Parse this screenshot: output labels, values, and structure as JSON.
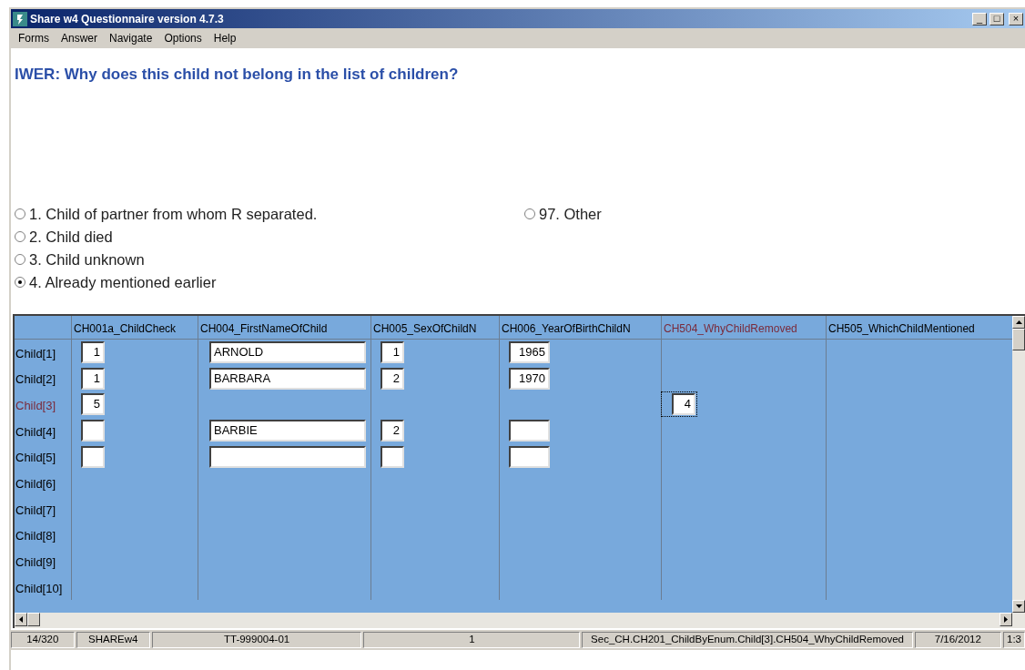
{
  "window": {
    "title": "Share w4 Questionnaire version 4.7.3",
    "controls": [
      "_",
      "□",
      "×"
    ]
  },
  "menu": [
    "Forms",
    "Answer",
    "Navigate",
    "Options",
    "Help"
  ],
  "question": "IWER: Why does this child not belong in the list of children?",
  "option_columns": [
    [
      {
        "label": "1. Child of partner from whom R separated.",
        "selected": false
      },
      {
        "label": "2. Child died",
        "selected": false
      },
      {
        "label": "3. Child unknown",
        "selected": false
      },
      {
        "label": "4. Already mentioned earlier",
        "selected": true
      }
    ],
    [
      {
        "label": "97. Other",
        "selected": false
      }
    ]
  ],
  "table": {
    "columns": [
      {
        "header": "CH001a_ChildCheck",
        "current": false
      },
      {
        "header": "CH004_FirstNameOfChild",
        "current": false
      },
      {
        "header": "CH005_SexOfChildN",
        "current": false
      },
      {
        "header": "CH006_YearOfBirthChildN",
        "current": false
      },
      {
        "header": "CH504_WhyChildRemoved",
        "current": true
      },
      {
        "header": "CH505_WhichChildMentioned",
        "current": false
      }
    ],
    "rows": [
      {
        "label": "Child[1]",
        "current": false,
        "cells": [
          {
            "kind": "field",
            "value": "1"
          },
          {
            "kind": "field",
            "value": "ARNOLD"
          },
          {
            "kind": "field",
            "value": "1"
          },
          {
            "kind": "field",
            "value": "1965"
          },
          {
            "kind": "none"
          },
          {
            "kind": "none"
          }
        ]
      },
      {
        "label": "Child[2]",
        "current": false,
        "cells": [
          {
            "kind": "field",
            "value": "1"
          },
          {
            "kind": "field",
            "value": "BARBARA"
          },
          {
            "kind": "field",
            "value": "2"
          },
          {
            "kind": "field",
            "value": "1970"
          },
          {
            "kind": "none"
          },
          {
            "kind": "none"
          }
        ]
      },
      {
        "label": "Child[3]",
        "current": true,
        "cells": [
          {
            "kind": "field",
            "value": "5"
          },
          {
            "kind": "none"
          },
          {
            "kind": "none"
          },
          {
            "kind": "none"
          },
          {
            "kind": "field",
            "value": "4",
            "focused": true
          },
          {
            "kind": "none"
          }
        ]
      },
      {
        "label": "Child[4]",
        "current": false,
        "cells": [
          {
            "kind": "field"
          },
          {
            "kind": "field",
            "value": "BARBIE"
          },
          {
            "kind": "field",
            "value": "2"
          },
          {
            "kind": "field"
          },
          {
            "kind": "none"
          },
          {
            "kind": "none"
          }
        ]
      },
      {
        "label": "Child[5]",
        "current": false,
        "cells": [
          {
            "kind": "field"
          },
          {
            "kind": "field"
          },
          {
            "kind": "field"
          },
          {
            "kind": "field"
          },
          {
            "kind": "none"
          },
          {
            "kind": "none"
          }
        ]
      },
      {
        "label": "Child[6]",
        "current": false
      },
      {
        "label": "Child[7]",
        "current": false
      },
      {
        "label": "Child[8]",
        "current": false
      },
      {
        "label": "Child[9]",
        "current": false
      },
      {
        "label": "Child[10]",
        "current": false
      }
    ]
  },
  "status_bar": [
    "14/320",
    "SHAREw4",
    "TT-999004-01",
    "1",
    "Sec_CH.CH201_ChildByEnum.Child[3].CH504_WhyChildRemoved",
    "7/16/2012",
    "1:3"
  ]
}
